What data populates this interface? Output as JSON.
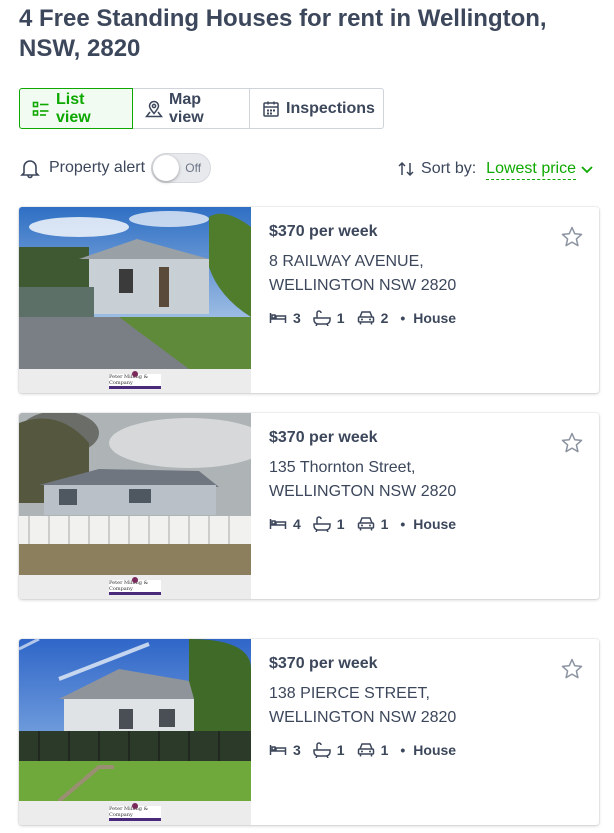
{
  "page": {
    "title": "4 Free Standing Houses for rent in Wellington, NSW, 2820"
  },
  "view_tabs": [
    {
      "label": "List view",
      "icon": "list-icon",
      "active": true
    },
    {
      "label": "Map view",
      "icon": "map-pin-icon",
      "active": false
    },
    {
      "label": "Inspections",
      "icon": "calendar-icon",
      "active": false
    }
  ],
  "alert": {
    "label": "Property alert",
    "toggle_state": "Off"
  },
  "sort": {
    "label": "Sort by:",
    "value": "Lowest price"
  },
  "listings": [
    {
      "price": "$370 per week",
      "address_line1": "8 RAILWAY AVENUE,",
      "address_line2": "WELLINGTON NSW 2820",
      "beds": "3",
      "baths": "1",
      "parking": "2",
      "property_type": "House",
      "agency": "Peter Milling & Company"
    },
    {
      "price": "$370 per week",
      "address_line1": "135 Thornton Street,",
      "address_line2": "WELLINGTON NSW 2820",
      "beds": "4",
      "baths": "1",
      "parking": "1",
      "property_type": "House",
      "agency": "Peter Milling & Company"
    },
    {
      "price": "$370 per week",
      "address_line1": "138 PIERCE STREET,",
      "address_line2": "WELLINGTON NSW 2820",
      "beds": "3",
      "baths": "1",
      "parking": "1",
      "property_type": "House",
      "agency": "Peter Milling & Company"
    }
  ],
  "colors": {
    "accent": "#0ea800",
    "text": "#3c475b",
    "agency_brand": "#4a2a7a"
  }
}
